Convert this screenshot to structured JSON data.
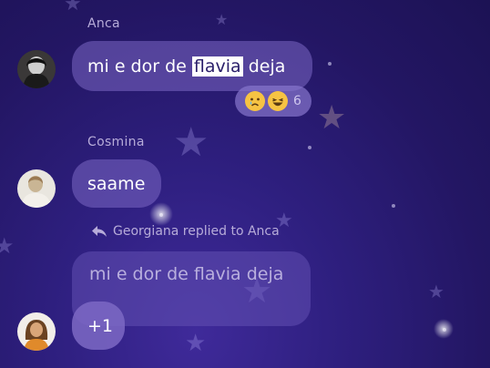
{
  "messages": [
    {
      "sender": "Anca",
      "text_before": "mi e dor de ",
      "text_highlight": "flavia",
      "text_after": " deja",
      "reactions": {
        "emojis": [
          "crying-face",
          "laughing-face"
        ],
        "count": "6"
      }
    },
    {
      "sender": "Cosmina",
      "text": "saame"
    },
    {
      "reply_label": "Georgiana replied to Anca",
      "quoted_text": "mi e dor de flavia deja",
      "text": "+1"
    }
  ],
  "colors": {
    "background": "#2a1b6e",
    "bubble": "#7c68c4",
    "highlight": "#ffffff",
    "sender_text": "#b7acd9"
  }
}
